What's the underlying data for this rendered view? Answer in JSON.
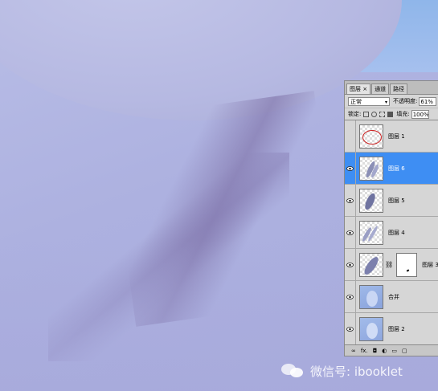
{
  "panel": {
    "tabs": [
      "图层 ×",
      "通道",
      "路径"
    ],
    "blend_mode": "正常",
    "opacity_label": "不透明度:",
    "opacity_value": "61%",
    "lock_label": "锁定:",
    "fill_label": "填充:",
    "fill_value": "100%",
    "bottom_icons": [
      "link-icon",
      "fx-icon",
      "mask-icon",
      "adjustment-icon",
      "folder-icon",
      "new-layer-icon",
      "trash-icon"
    ],
    "bottom_fx": "fx.",
    "selected_color": "#3e8ef3"
  },
  "layers": [
    {
      "name": "图层 1",
      "visible": false,
      "selected": false
    },
    {
      "name": "图层 6",
      "visible": true,
      "selected": true
    },
    {
      "name": "图层 5",
      "visible": true,
      "selected": false
    },
    {
      "name": "图层 4",
      "visible": true,
      "selected": false
    },
    {
      "name": "图层 3",
      "visible": true,
      "selected": false,
      "has_mask": true
    },
    {
      "name": "合并",
      "visible": true,
      "selected": false
    },
    {
      "name": "图层 2",
      "visible": true,
      "selected": false
    }
  ],
  "watermark": {
    "text": "微信号: ibooklet"
  }
}
